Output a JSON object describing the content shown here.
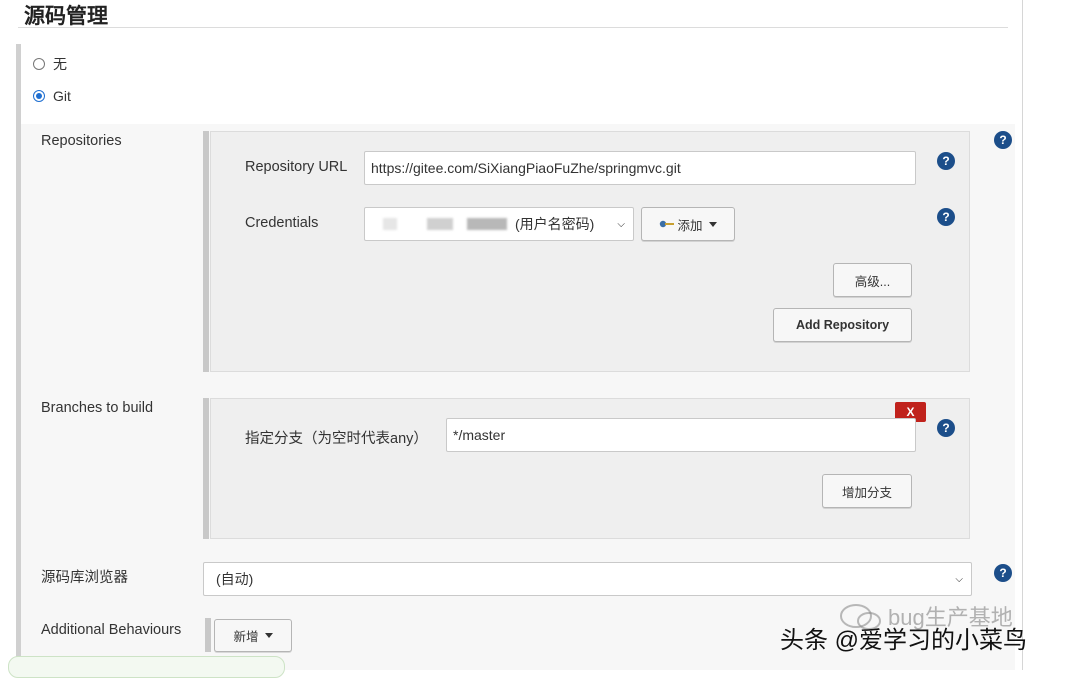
{
  "section": {
    "title": "源码管理"
  },
  "scm_options": [
    {
      "label": "无",
      "checked": false
    },
    {
      "label": "Git",
      "checked": true
    }
  ],
  "repositories": {
    "label": "Repositories",
    "url_label": "Repository URL",
    "url_value": "https://gitee.com/SiXiangPiaoFuZhe/springmvc.git",
    "credentials_label": "Credentials",
    "credentials_value": "(用户名密码)",
    "add_button": "添加",
    "advanced_button": "高级...",
    "add_repository_button": "Add Repository"
  },
  "branches": {
    "label": "Branches to build",
    "specifier_label": "指定分支（为空时代表any）",
    "specifier_value": "*/master",
    "delete_button": "X",
    "add_branch_button": "增加分支"
  },
  "browser": {
    "label": "源码库浏览器",
    "value": "(自动)"
  },
  "behaviours": {
    "label": "Additional Behaviours",
    "add_button": "新增"
  },
  "help_icon_text": "?",
  "watermark": {
    "line1": "bug生产基地",
    "line2": "头条 @爱学习的小菜鸟"
  },
  "colors": {
    "help_icon": "#1c4e8a",
    "delete_button": "#c0221c",
    "radio_accent": "#1f6fd1"
  }
}
